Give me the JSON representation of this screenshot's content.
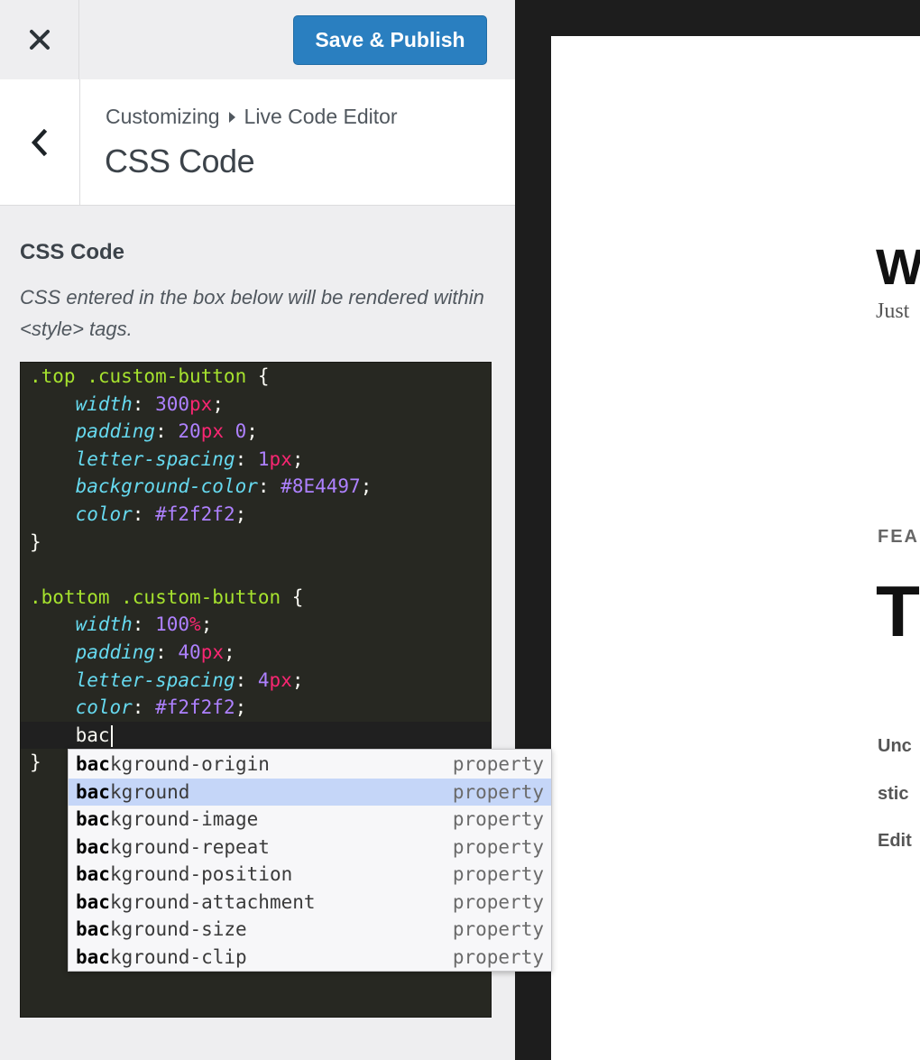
{
  "header": {
    "close_icon": "close-icon",
    "publish_label": "Save & Publish",
    "publish_color": "#2a7fc0"
  },
  "section": {
    "back_icon": "chevron-left-icon",
    "breadcrumb_root": "Customizing",
    "breadcrumb_current": "Live Code Editor",
    "title": "CSS Code"
  },
  "control": {
    "label": "CSS Code",
    "description": "CSS entered in the box below will be rendered within <style> tags."
  },
  "editor": {
    "theme_colors": {
      "background": "#272822",
      "selector": "#a6e22e",
      "property": "#66d9ef",
      "number": "#ae81ff",
      "unit": "#f92672"
    },
    "lines": [
      ".top .custom-button {",
      "    width: 300px;",
      "    padding: 20px 0;",
      "    letter-spacing: 1px;",
      "    background-color: #8E4497;",
      "    color: #f2f2f2;",
      "}",
      "",
      ".bottom .custom-button {",
      "    width: 100%;",
      "    padding: 40px;",
      "    letter-spacing: 4px;",
      "    color: #f2f2f2;",
      "    bac",
      "}"
    ],
    "typed_prefix": "bac"
  },
  "autocomplete": {
    "selected_index": 1,
    "items": [
      {
        "match": "bac",
        "rest": "kground-origin",
        "meta": "property"
      },
      {
        "match": "bac",
        "rest": "kground",
        "meta": "property"
      },
      {
        "match": "bac",
        "rest": "kground-image",
        "meta": "property"
      },
      {
        "match": "bac",
        "rest": "kground-repeat",
        "meta": "property"
      },
      {
        "match": "bac",
        "rest": "kground-position",
        "meta": "property"
      },
      {
        "match": "bac",
        "rest": "kground-attachment",
        "meta": "property"
      },
      {
        "match": "bac",
        "rest": "kground-size",
        "meta": "property"
      },
      {
        "match": "bac",
        "rest": "kground-clip",
        "meta": "property"
      }
    ]
  },
  "preview": {
    "site_title": "W",
    "tagline": "Just",
    "featured_label": "FEA",
    "post_heading": "T",
    "text_lines": [
      "Unc",
      "stic",
      "Edit"
    ]
  }
}
